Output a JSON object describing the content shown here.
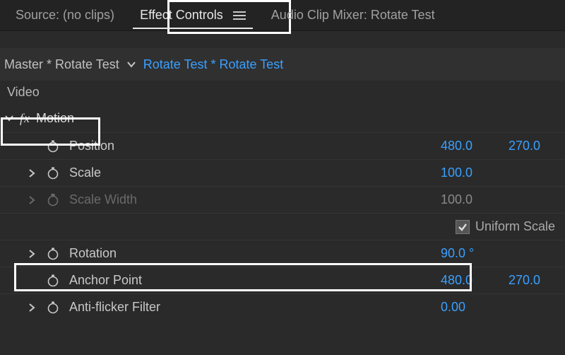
{
  "tabs": {
    "source": "Source: (no clips)",
    "effect_controls": "Effect Controls",
    "audio_mixer": "Audio Clip Mixer: Rotate Test"
  },
  "cliprow": {
    "master": "Master * Rotate Test",
    "clip": "Rotate Test * Rotate Test"
  },
  "section_video": "Video",
  "effect_motion": {
    "fx": "fx",
    "name": "Motion"
  },
  "props": {
    "position": {
      "label": "Position",
      "x": "480.0",
      "y": "270.0"
    },
    "scale": {
      "label": "Scale",
      "value": "100.0"
    },
    "scale_width": {
      "label": "Scale Width",
      "value": "100.0"
    },
    "uniform_scale": {
      "label": "Uniform Scale",
      "checked": true
    },
    "rotation": {
      "label": "Rotation",
      "value": "90.0 °"
    },
    "anchor": {
      "label": "Anchor Point",
      "x": "480.0",
      "y": "270.0"
    },
    "antiflicker": {
      "label": "Anti-flicker Filter",
      "value": "0.00"
    }
  }
}
